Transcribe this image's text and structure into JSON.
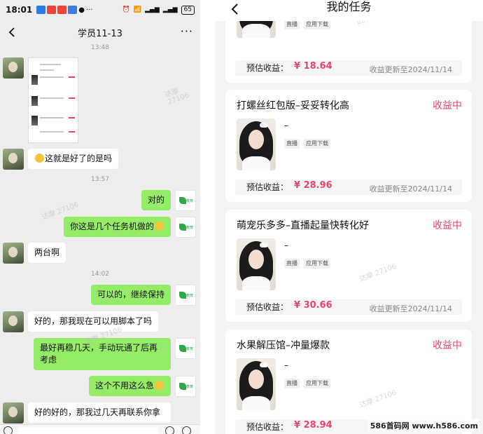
{
  "chat": {
    "status": {
      "time": "18:01",
      "battery": "65"
    },
    "header": {
      "title": "学员11-13"
    },
    "times": [
      "13:48",
      "13:57",
      "14:02"
    ],
    "messages": [
      {
        "side": "left",
        "text": "这就是好了的是吗"
      },
      {
        "side": "right",
        "text": "对的"
      },
      {
        "side": "right",
        "text": "你这是几个任务机做的"
      },
      {
        "side": "left",
        "text": "两台啊"
      },
      {
        "side": "right",
        "text": "可以的，继续保持"
      },
      {
        "side": "left",
        "text": "好的，那我现在可以用脚本了吗"
      },
      {
        "side": "right",
        "text": "最好再稳几天，手动玩通了后再考虑"
      },
      {
        "side": "right",
        "text": "这个不用这么急"
      },
      {
        "side": "left",
        "text": "好的好的，那我过几天再联系你拿"
      }
    ]
  },
  "tasks": {
    "title": "我的任务",
    "income_label": "预估收益：",
    "top_partial": {
      "value": "¥ 18.64",
      "update": "收益更新至2024/11/14"
    },
    "cards": [
      {
        "name": "打螺丝红包版–妥妥转化高",
        "status": "收益中",
        "desc": "–",
        "tags": [
          "直播",
          "应用下载"
        ],
        "value": "¥ 28.96",
        "update": "收益更新至2024/11/14"
      },
      {
        "name": "萌宠乐多多–直播起量快转化好",
        "status": "收益中",
        "desc": "–",
        "tags": [
          "直播",
          "应用下载"
        ],
        "value": "¥ 30.66",
        "update": "收益更新至2024/11/14"
      },
      {
        "name": "水果解压馆–冲量爆款",
        "status": "收益中",
        "desc": "–",
        "tags": [
          "直播",
          "应用下载"
        ],
        "value": "¥ 28.94",
        "update": ""
      }
    ],
    "top_tags": [
      "直播",
      "应用下载"
    ]
  },
  "watermark": {
    "repeat": "达摩 27106",
    "footer": "586首码网 www.h586.com"
  },
  "colors": {
    "accent": "#e8456b",
    "chat_green": "#95ec69",
    "chat_bg": "#ededed"
  }
}
